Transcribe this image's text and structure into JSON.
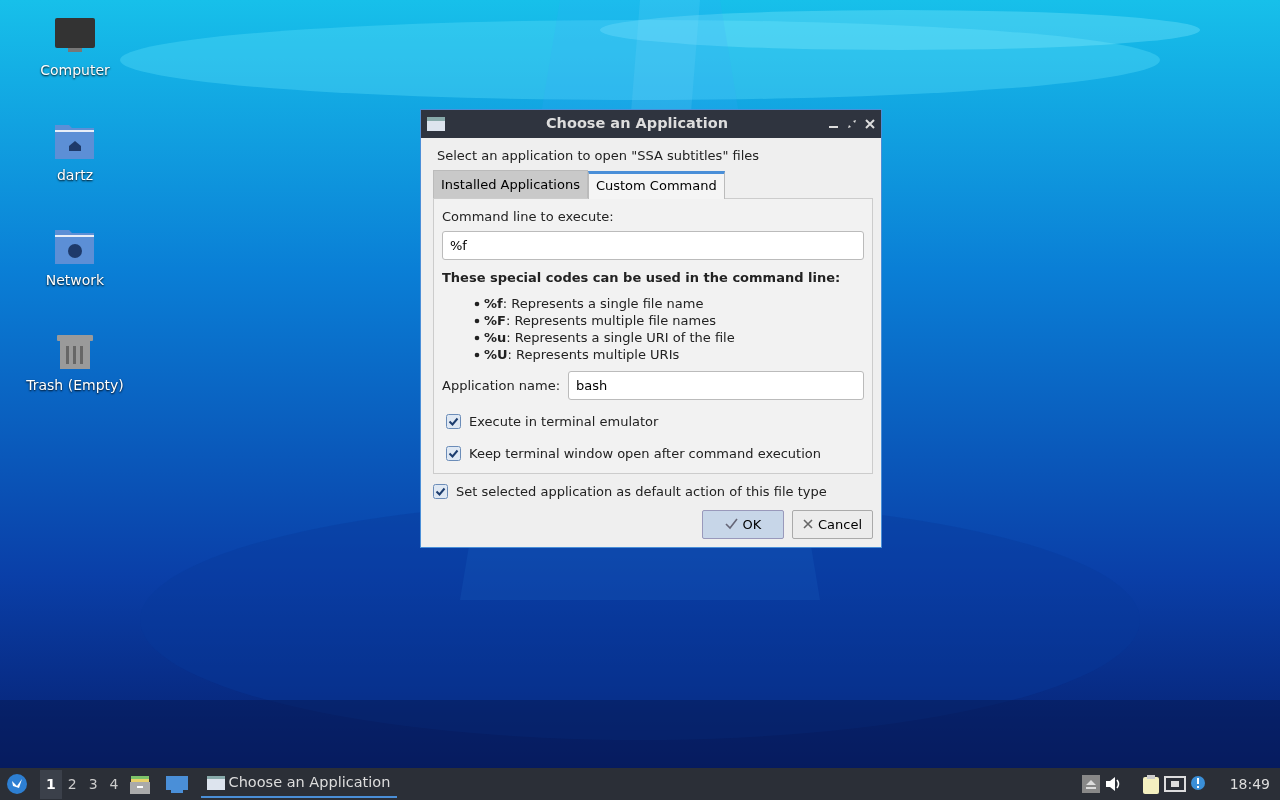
{
  "desktop_icons": [
    {
      "label": "Computer",
      "kind": "computer"
    },
    {
      "label": "dartz",
      "kind": "home"
    },
    {
      "label": "Network",
      "kind": "network"
    },
    {
      "label": "Trash (Empty)",
      "kind": "trash"
    }
  ],
  "dialog": {
    "title": "Choose an Application",
    "prompt": "Select an application to open \"SSA subtitles\" files",
    "tabs": [
      {
        "label": "Installed Applications",
        "selected": false
      },
      {
        "label": "Custom Command",
        "selected": true
      }
    ],
    "command_label": "Command line to execute:",
    "command_value": "%f",
    "codes_heading": "These special codes can be used in the command line:",
    "codes": [
      "**%f**: Represents a single file name",
      "**%F**: Represents multiple file names",
      "**%u**: Represents a single URI of the file",
      "**%U**: Represents multiple URIs"
    ],
    "app_name_label": "Application name:",
    "app_name_value": "bash",
    "options": [
      {
        "label": "Execute in terminal emulator",
        "checked": true
      },
      {
        "label": "Keep terminal window open after command execution",
        "checked": true
      }
    ],
    "default_option": {
      "label": "Set selected application as default action of this file type",
      "checked": true
    },
    "buttons": [
      {
        "label": "OK",
        "kind": "ok"
      },
      {
        "label": "Cancel",
        "kind": "cancel"
      }
    ]
  },
  "taskbar": {
    "workspaces": [
      {
        "label": "1",
        "selected": true
      },
      {
        "label": "2",
        "selected": false
      },
      {
        "label": "3",
        "selected": false
      },
      {
        "label": "4",
        "selected": false
      }
    ],
    "task": "Choose an Application",
    "clock": "18:49"
  }
}
